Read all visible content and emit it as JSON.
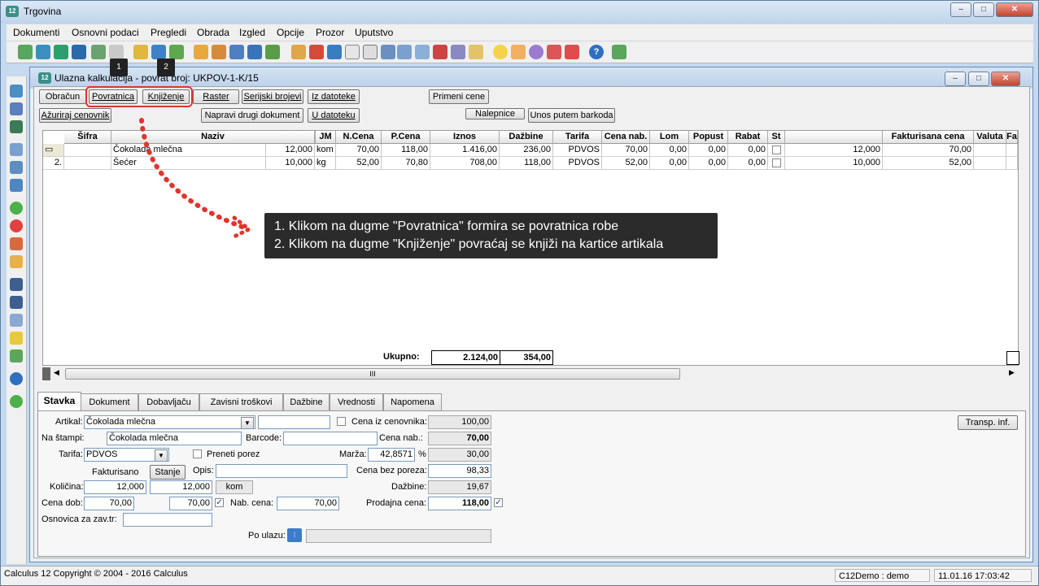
{
  "window": {
    "title": "Trgovina",
    "icon_label": "12"
  },
  "menu": [
    "Dokumenti",
    "Osnovni podaci",
    "Pregledi",
    "Obrada",
    "Izgled",
    "Opcije",
    "Prozor",
    "Uputstvo"
  ],
  "child": {
    "title": "Ulazna kalkulacija - povrat broj: UKPOV-1-K/15"
  },
  "buttons_row1": [
    "Obračun",
    "Povratnica",
    "Knjiženje",
    "Raster",
    "Serijski brojevi",
    "Iz datoteke",
    "Primeni cene"
  ],
  "buttons_row2": [
    "Ažuriraj cenovnik",
    "Napravi drugi dokument",
    "U datoteku",
    "Nalepnice",
    "Unos putem barkoda"
  ],
  "callouts": {
    "n1": "1",
    "n2": "2"
  },
  "tooltip": {
    "line1": "1. Klikom na dugme \"Povratnica\" formira se povratnica robe",
    "line2": "2. Klikom na dugme \"Knjiženje\" povraćaj se knjiži na kartice artikala"
  },
  "grid": {
    "headers": [
      "Šifra",
      "Naziv",
      "JM",
      "N.Cena",
      "P.Cena",
      "Iznos",
      "Dažbine",
      "Tarifa",
      "Cena nab.",
      "Lom",
      "Popust",
      "Rabat",
      "St",
      "Fakturisana cena",
      "Valuta",
      "Fa"
    ],
    "rows": [
      {
        "rb": "",
        "sifra": "",
        "naziv": "Čokolada mlečna",
        "kol": "12,000",
        "jm": "kom",
        "ncena": "70,00",
        "pcena": "118,00",
        "iznos": "1.416,00",
        "dazbine": "236,00",
        "tarifa": "PDVOS",
        "cenanab": "70,00",
        "lom": "0,00",
        "popust": "0,00",
        "rabat": "0,00",
        "fkol": "12,000",
        "fcena": "70,00"
      },
      {
        "rb": "2.",
        "sifra": "",
        "naziv": "Šećer",
        "kol": "10,000",
        "jm": "kg",
        "ncena": "52,00",
        "pcena": "70,80",
        "iznos": "708,00",
        "dazbine": "118,00",
        "tarifa": "PDVOS",
        "cenanab": "52,00",
        "lom": "0,00",
        "popust": "0,00",
        "rabat": "0,00",
        "fkol": "10,000",
        "fcena": "52,00"
      }
    ],
    "total_label": "Ukupno:",
    "total_iznos": "2.124,00",
    "total_dazbine": "354,00",
    "scroll_grip": "III"
  },
  "tabs": [
    "Stavka",
    "Dokument",
    "Dobavljaču",
    "Zavisni troškovi",
    "Dažbine",
    "Vrednosti",
    "Napomena"
  ],
  "form": {
    "artikal_label": "Artikal:",
    "artikal": "Čokolada mlečna",
    "cena_iz_cen_label": "Cena iz cenovnika:",
    "cena_iz_cen": "100,00",
    "na_stampi_label": "Na štampi:",
    "na_stampi": "Čokolada mlečna",
    "barcode_label": "Barcode:",
    "barcode": "",
    "cena_nab_label": "Cena nab.:",
    "cena_nab": "70,00",
    "tarifa_label": "Tarifa:",
    "tarifa": "PDVOS",
    "preneti_porez_label": "Preneti porez",
    "marza_label": "Marža:",
    "marza": "42,8571",
    "pct": "%",
    "marza_val": "30,00",
    "fakturisano_label": "Fakturisano",
    "stanje_button": "Stanje",
    "opis_label": "Opis:",
    "opis": "",
    "cena_bez_poreza_label": "Cena bez poreza:",
    "cena_bez_poreza": "98,33",
    "kolicina_label": "Količina:",
    "kolicina": "12,000",
    "kolicina2": "12,000",
    "jm": "kom",
    "dazbine_label": "Dažbine:",
    "dazbine": "19,67",
    "cena_dob_label": "Cena dob:",
    "cena_dob": "70,00",
    "cena_dob2": "70,00",
    "nab_cena_label": "Nab. cena:",
    "nab_cena": "70,00",
    "prodajna_cena_label": "Prodajna cena:",
    "prodajna_cena": "118,00",
    "osnovica_label": "Osnovica za zav.tr:",
    "osnovica": "",
    "po_ulazu_label": "Po ulazu:",
    "transp_button": "Transp. inf."
  },
  "status": {
    "left": "Calculus 12  Copyright © 2004 - 2016  Calculus",
    "user": "C12Demo : demo",
    "datetime": "11.01.16 17:03:42"
  },
  "colors": {
    "accent_red": "#e0342c",
    "title_bg": "#c5d9ef",
    "tooltip_bg": "#2b2b2b"
  }
}
